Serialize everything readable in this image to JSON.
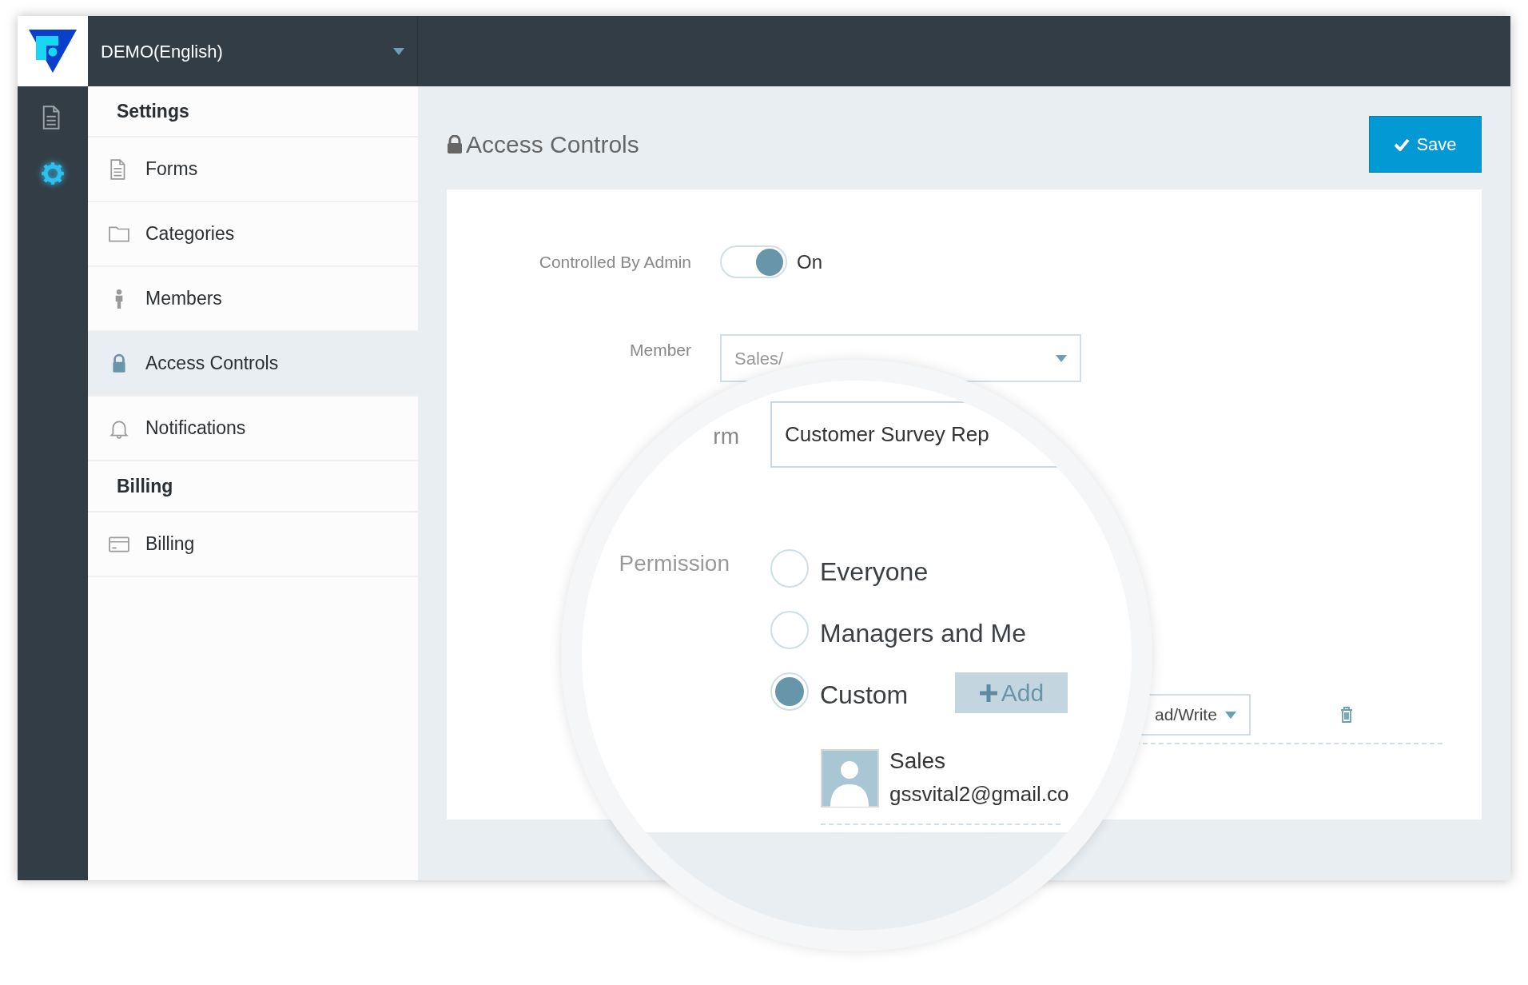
{
  "workspace": {
    "name": "DEMO(English)"
  },
  "rail": [
    {
      "kind": "document",
      "selected": false
    },
    {
      "kind": "gear",
      "selected": true
    }
  ],
  "sidebar": {
    "sections": [
      {
        "title": "Settings",
        "items": [
          {
            "label": "Forms",
            "kind": "document",
            "selected": false
          },
          {
            "label": "Categories",
            "kind": "folder",
            "selected": false
          },
          {
            "label": "Members",
            "kind": "person",
            "selected": false
          },
          {
            "label": "Access Controls",
            "kind": "lock",
            "selected": true
          },
          {
            "label": "Notifications",
            "kind": "bell",
            "selected": false
          }
        ]
      },
      {
        "title": "Billing",
        "items": [
          {
            "label": "Billing",
            "kind": "card",
            "selected": false
          }
        ]
      }
    ]
  },
  "page": {
    "title": "Access Controls",
    "save_button": "Save"
  },
  "controlled_by_admin": {
    "label": "Controlled By Admin",
    "on": true,
    "state_text": "On"
  },
  "member": {
    "label": "Member",
    "value": "Sales/"
  },
  "access_row": {
    "permission_value": "ad/Write"
  },
  "magnifier": {
    "form_label": "rm",
    "form_value": "Customer Survey Rep",
    "permission_label": "Permission",
    "options": [
      {
        "label": "Everyone",
        "selected": false
      },
      {
        "label": "Managers and Me",
        "selected": false
      },
      {
        "label": "Custom",
        "selected": true
      }
    ],
    "add_button": "Add",
    "member_card": {
      "name": "Sales",
      "email": "gssvital2@gmail.co"
    }
  }
}
